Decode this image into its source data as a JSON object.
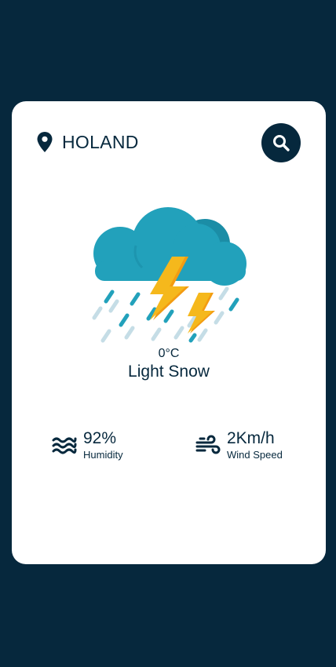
{
  "location": {
    "icon": "map-pin-icon",
    "city": "HOLAND"
  },
  "search": {
    "icon": "search-icon"
  },
  "weather": {
    "image": "thunderstorm-rain-icon",
    "temperature": "0°C",
    "description": "Light Snow"
  },
  "details": {
    "humidity": {
      "icon": "waves-icon",
      "value": "92%",
      "label": "Humidity"
    },
    "wind": {
      "icon": "wind-icon",
      "value": "2Km/h",
      "label": "Wind Speed"
    }
  },
  "colors": {
    "background": "#06283d",
    "card": "#ffffff",
    "cloud": "#22a1bb",
    "bolt": "#f5b81c",
    "rain_light": "#c5dde6"
  }
}
